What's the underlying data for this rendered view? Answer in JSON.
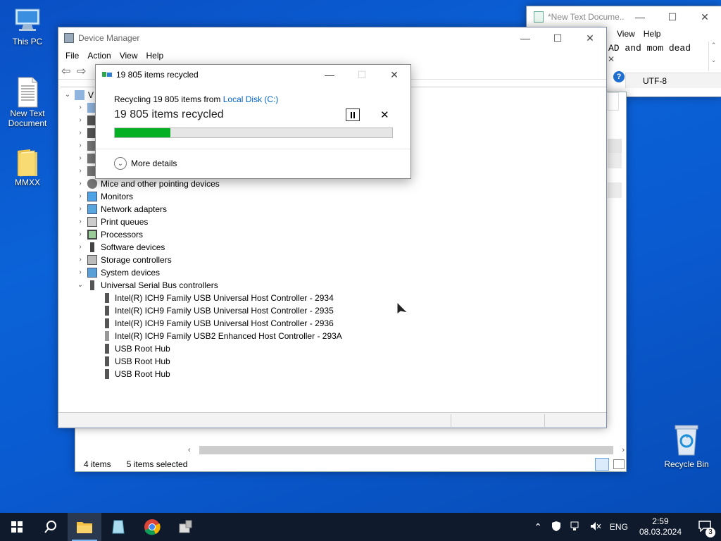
{
  "desktop": {
    "icons": [
      {
        "name": "this-pc",
        "label": "This PC"
      },
      {
        "name": "new-text-document",
        "label": "New Text\nDocument"
      },
      {
        "name": "mmxx-folder",
        "label": "MMXX"
      },
      {
        "name": "recycle-bin",
        "label": "Recycle Bin"
      }
    ]
  },
  "notepad": {
    "title": "*New Text Docume...",
    "menu": [
      "View",
      "Help"
    ],
    "text": "AD and mom dead",
    "encoding": "UTF-8"
  },
  "explorer": {
    "status_count": "4 items",
    "status_selected": "5 items selected"
  },
  "device_manager": {
    "title": "Device Manager",
    "menu": [
      "File",
      "Action",
      "View",
      "Help"
    ],
    "root_label": "V",
    "categories": [
      "Mice and other pointing devices",
      "Monitors",
      "Network adapters",
      "Print queues",
      "Processors",
      "Software devices",
      "Storage controllers",
      "System devices",
      "Universal Serial Bus controllers"
    ],
    "usb_devices": [
      "Intel(R) ICH9 Family USB Universal Host Controller - 2934",
      "Intel(R) ICH9 Family USB Universal Host Controller - 2935",
      "Intel(R) ICH9 Family USB Universal Host Controller - 2936",
      "Intel(R) ICH9 Family USB2 Enhanced Host Controller - 293A",
      "USB Root Hub",
      "USB Root Hub",
      "USB Root Hub"
    ]
  },
  "dialog": {
    "title": "19 805 items recycled",
    "line1_prefix": "Recycling 19 805 items from ",
    "source_link": "Local Disk (C:)",
    "heading": "19 805 items recycled",
    "progress": 0.2,
    "more_details": "More details",
    "colors": {
      "progress": "#06b025",
      "link": "#0066cc"
    }
  },
  "taskbar": {
    "language": "ENG",
    "time": "2:59",
    "date": "08.03.2024",
    "notification_count": "3"
  }
}
